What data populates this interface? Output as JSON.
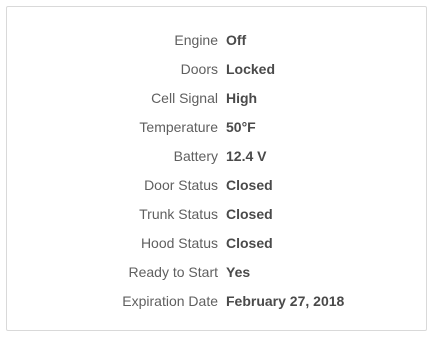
{
  "status": {
    "rows": [
      {
        "label": "Engine",
        "value": "Off"
      },
      {
        "label": "Doors",
        "value": "Locked"
      },
      {
        "label": "Cell Signal",
        "value": "High"
      },
      {
        "label": "Temperature",
        "value": "50°F"
      },
      {
        "label": "Battery",
        "value": "12.4 V"
      },
      {
        "label": "Door Status",
        "value": "Closed"
      },
      {
        "label": "Trunk Status",
        "value": "Closed"
      },
      {
        "label": "Hood Status",
        "value": "Closed"
      },
      {
        "label": "Ready to Start",
        "value": "Yes"
      },
      {
        "label": "Expiration Date",
        "value": "February 27, 2018"
      }
    ]
  }
}
